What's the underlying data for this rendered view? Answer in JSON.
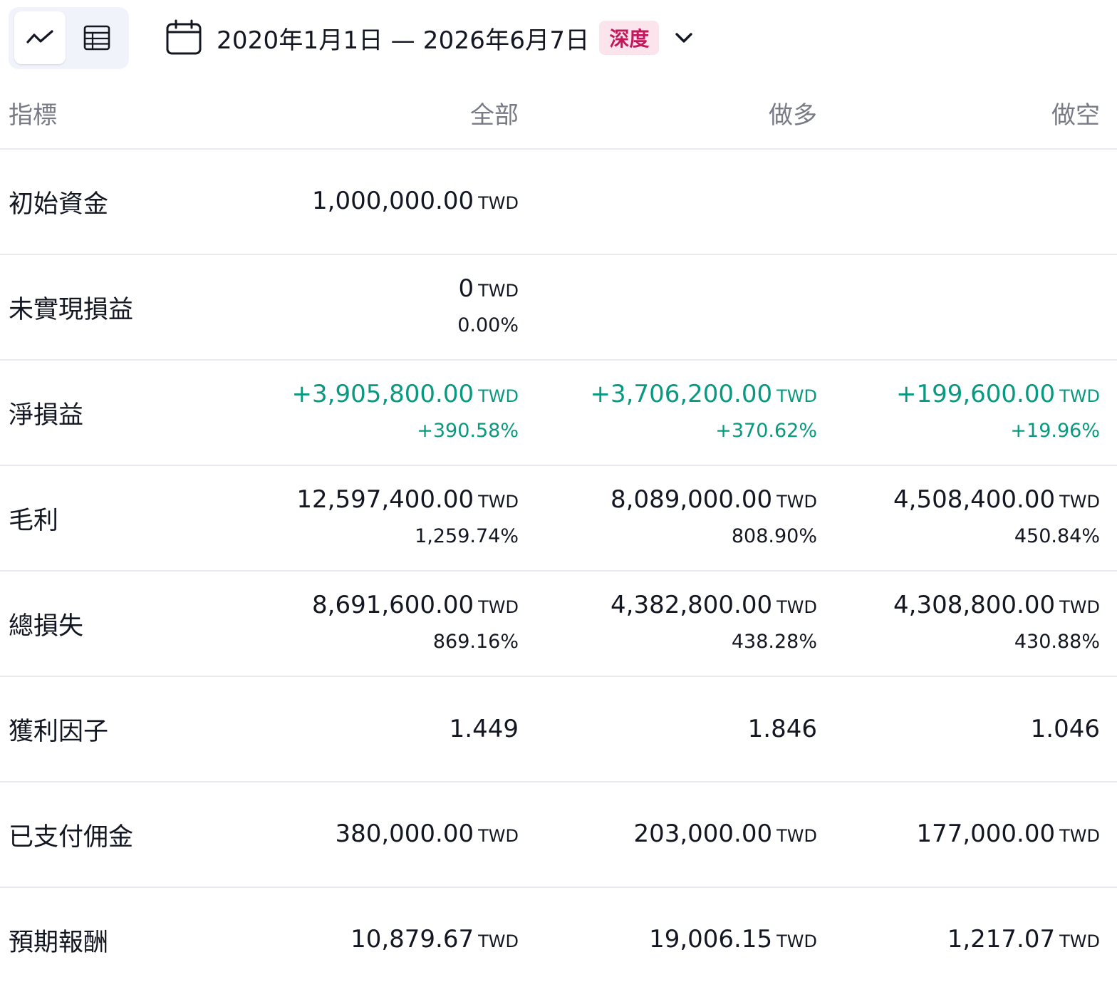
{
  "toolbar": {
    "chart_view_icon": "trend-line-icon",
    "table_view_icon": "table-icon",
    "calendar_icon": "calendar-icon",
    "date_range": "2020年1月1日 — 2026年6月7日",
    "mode_badge": "深度",
    "dropdown_icon": "chevron-down-icon"
  },
  "colors": {
    "positive": "#089981",
    "badge_bg": "#fce4ec",
    "badge_text": "#c2185b"
  },
  "table": {
    "headers": [
      "指標",
      "全部",
      "做多",
      "做空"
    ],
    "currency": "TWD",
    "rows": [
      {
        "label": "初始資金",
        "all": {
          "value": "1,000,000.00",
          "unit": "TWD",
          "pct": ""
        },
        "long": {
          "value": "",
          "unit": "",
          "pct": ""
        },
        "short": {
          "value": "",
          "unit": "",
          "pct": ""
        }
      },
      {
        "label": "未實現損益",
        "all": {
          "value": "0",
          "unit": "TWD",
          "pct": "0.00%"
        },
        "long": {
          "value": "",
          "unit": "",
          "pct": ""
        },
        "short": {
          "value": "",
          "unit": "",
          "pct": ""
        }
      },
      {
        "label": "淨損益",
        "all": {
          "value": "+3,905,800.00",
          "unit": "TWD",
          "pct": "+390.58%"
        },
        "long": {
          "value": "+3,706,200.00",
          "unit": "TWD",
          "pct": "+370.62%"
        },
        "short": {
          "value": "+199,600.00",
          "unit": "TWD",
          "pct": "+19.96%"
        }
      },
      {
        "label": "毛利",
        "all": {
          "value": "12,597,400.00",
          "unit": "TWD",
          "pct": "1,259.74%"
        },
        "long": {
          "value": "8,089,000.00",
          "unit": "TWD",
          "pct": "808.90%"
        },
        "short": {
          "value": "4,508,400.00",
          "unit": "TWD",
          "pct": "450.84%"
        }
      },
      {
        "label": "總損失",
        "all": {
          "value": "8,691,600.00",
          "unit": "TWD",
          "pct": "869.16%"
        },
        "long": {
          "value": "4,382,800.00",
          "unit": "TWD",
          "pct": "438.28%"
        },
        "short": {
          "value": "4,308,800.00",
          "unit": "TWD",
          "pct": "430.88%"
        }
      },
      {
        "label": "獲利因子",
        "all": {
          "value": "1.449",
          "unit": "",
          "pct": ""
        },
        "long": {
          "value": "1.846",
          "unit": "",
          "pct": ""
        },
        "short": {
          "value": "1.046",
          "unit": "",
          "pct": ""
        }
      },
      {
        "label": "已支付佣金",
        "all": {
          "value": "380,000.00",
          "unit": "TWD",
          "pct": ""
        },
        "long": {
          "value": "203,000.00",
          "unit": "TWD",
          "pct": ""
        },
        "short": {
          "value": "177,000.00",
          "unit": "TWD",
          "pct": ""
        }
      },
      {
        "label": "預期報酬",
        "all": {
          "value": "10,879.67",
          "unit": "TWD",
          "pct": ""
        },
        "long": {
          "value": "19,006.15",
          "unit": "TWD",
          "pct": ""
        },
        "short": {
          "value": "1,217.07",
          "unit": "TWD",
          "pct": ""
        }
      }
    ]
  }
}
